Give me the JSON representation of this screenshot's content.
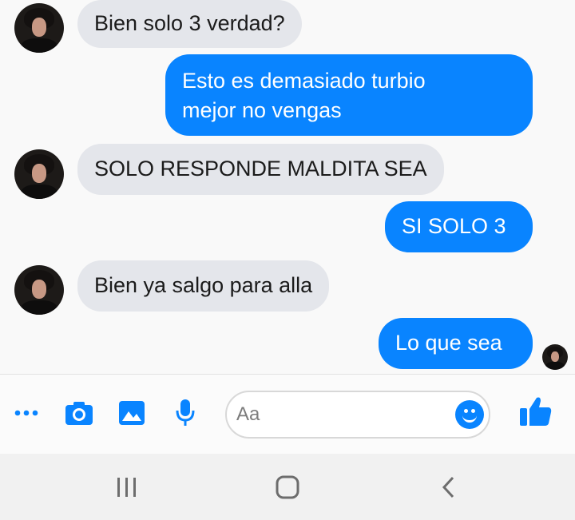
{
  "messages": [
    {
      "direction": "incoming",
      "text": "Bien solo 3 verdad?"
    },
    {
      "direction": "outgoing",
      "lines": [
        "Esto es demasiado turbio",
        "mejor no vengas"
      ]
    },
    {
      "direction": "incoming",
      "text": "SOLO RESPONDE MALDITA SEA"
    },
    {
      "direction": "outgoing",
      "text": "SI SOLO 3"
    },
    {
      "direction": "incoming",
      "text": "Bien ya salgo para alla"
    },
    {
      "direction": "outgoing",
      "text": "Lo que sea"
    }
  ],
  "composer": {
    "placeholder": "Aa",
    "tools": [
      "more-icon",
      "camera-icon",
      "gallery-icon",
      "microphone-icon"
    ],
    "emoji_icon": "emoji-icon",
    "like_icon": "thumbs-up-icon"
  },
  "navbar": {
    "buttons": [
      "recent-apps-icon",
      "home-icon",
      "back-icon"
    ]
  },
  "colors": {
    "outgoing_bubble": "#0984ff",
    "incoming_bubble": "#e4e6eb",
    "accent": "#0984ff"
  }
}
